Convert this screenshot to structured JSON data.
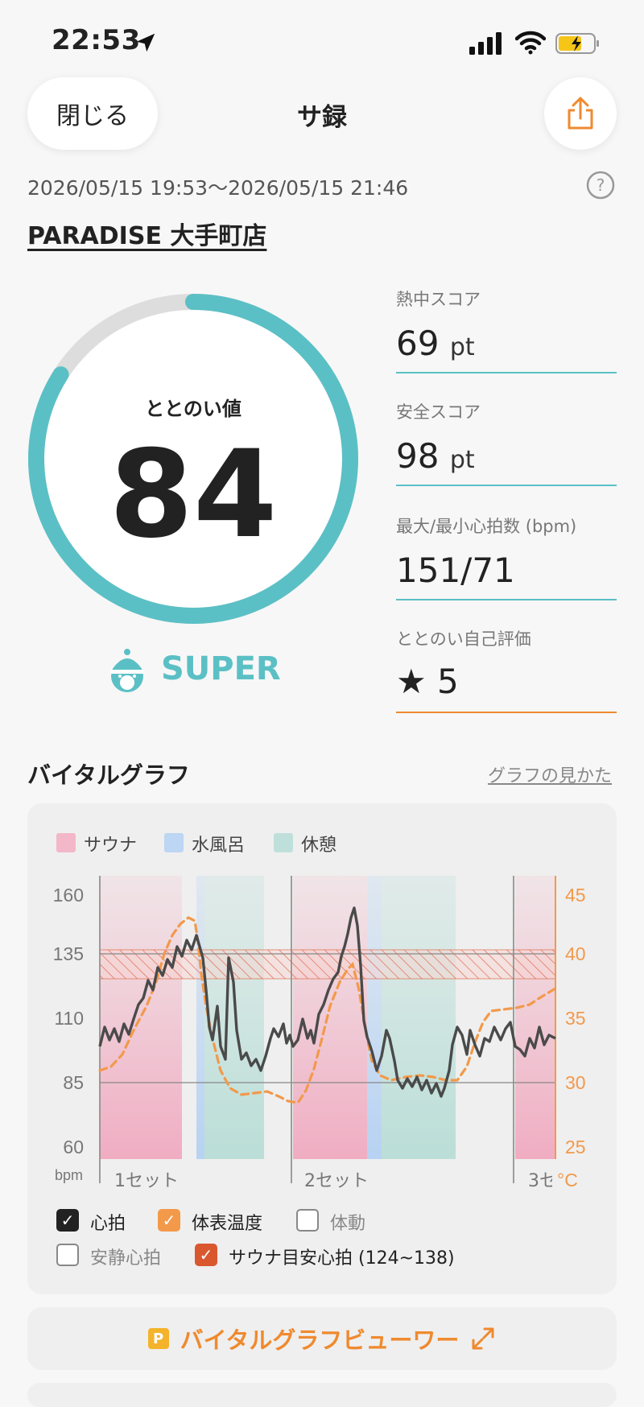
{
  "status_bar": {
    "time": "22:53"
  },
  "nav": {
    "close_label": "閉じる",
    "title": "サ録"
  },
  "session": {
    "date_range": "2026/05/15 19:53〜2026/05/15 21:46",
    "store_name": "PARADISE 大手町店"
  },
  "score": {
    "label": "ととのい値",
    "value": "84",
    "fraction": 0.84,
    "rank": "SUPER"
  },
  "metrics": [
    {
      "label": "熱中スコア",
      "value": "69",
      "unit": "pt"
    },
    {
      "label": "安全スコア",
      "value": "98",
      "unit": "pt"
    },
    {
      "label": "最大/最小心拍数 (bpm)",
      "value": "151/71",
      "unit": ""
    },
    {
      "label": "ととのい自己評価",
      "value": "★ 5",
      "unit": ""
    }
  ],
  "vital_graph": {
    "title": "バイタルグラフ",
    "help_link": "グラフの見かた",
    "legend": [
      {
        "label": "サウナ",
        "color": "#f2b8c9"
      },
      {
        "label": "水風呂",
        "color": "#bcd6f3"
      },
      {
        "label": "休憩",
        "color": "#bfe0da"
      }
    ],
    "left_ticks": [
      "160",
      "135",
      "110",
      "85",
      "60"
    ],
    "left_unit": "bpm",
    "right_ticks": [
      "45",
      "40",
      "35",
      "30",
      "25"
    ],
    "right_unit": "°C",
    "set_labels": [
      "1セット",
      "2セット",
      "3セ"
    ],
    "checkboxes": [
      {
        "label": "心拍",
        "checked": true
      },
      {
        "label": "体表温度",
        "checked": true
      },
      {
        "label": "体動",
        "checked": false
      },
      {
        "label": "安静心拍",
        "checked": false
      },
      {
        "label": "サウナ目安心拍 (124~138)",
        "checked": true
      }
    ]
  },
  "viewer_button": {
    "badge": "P",
    "label": "バイタルグラフビューワー"
  },
  "colors": {
    "teal": "#5bc0c5",
    "orange": "#ef8a2f",
    "gray_track": "#dddddd"
  }
}
